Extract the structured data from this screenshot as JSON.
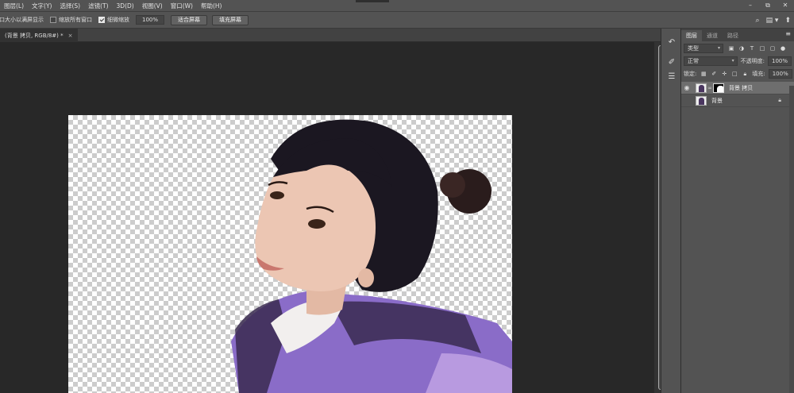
{
  "menu": [
    "图层(L)",
    "文字(Y)",
    "选择(S)",
    "滤镜(T)",
    "3D(D)",
    "视图(V)",
    "窗口(W)",
    "帮助(H)"
  ],
  "window_controls": [
    "–",
    "⧉",
    "✕"
  ],
  "options": {
    "fit_label": "调整窗口大小以满屏显示",
    "zoom_all_label": "缩放所有窗口",
    "zoom_all_checked": false,
    "scrubby_label": "细微缩放",
    "scrubby_checked": true,
    "zoom_value": "100%",
    "fit_screen_button": "适合屏幕",
    "fill_screen_button": "填充屏幕"
  },
  "document_tab": {
    "title": "(背景 拷贝, RGB/8#) *",
    "close": "×"
  },
  "panel": {
    "tabs": [
      "图层",
      "通道",
      "路径"
    ],
    "kind_filter": "类型",
    "blend_mode": "正常",
    "opacity_label": "不透明度:",
    "opacity_value": "100%",
    "lock_label": "锁定:",
    "fill_label": "填充:",
    "fill_value": "100%",
    "layers": [
      {
        "name": "背景 拷贝",
        "visible": true,
        "selected": true,
        "has_mask": true,
        "locked": false
      },
      {
        "name": "背景",
        "visible": false,
        "selected": false,
        "has_mask": false,
        "locked": true
      }
    ]
  },
  "colors": {
    "menubar": "#535353",
    "canvas_bg": "#282828",
    "panel_bg": "#535353",
    "selected_layer": "#6e6e6e"
  },
  "icons": {
    "search": "search-icon",
    "workspace": "workspace-icon",
    "share": "share-icon",
    "eye": "eye-icon",
    "lock": "lock-icon"
  }
}
